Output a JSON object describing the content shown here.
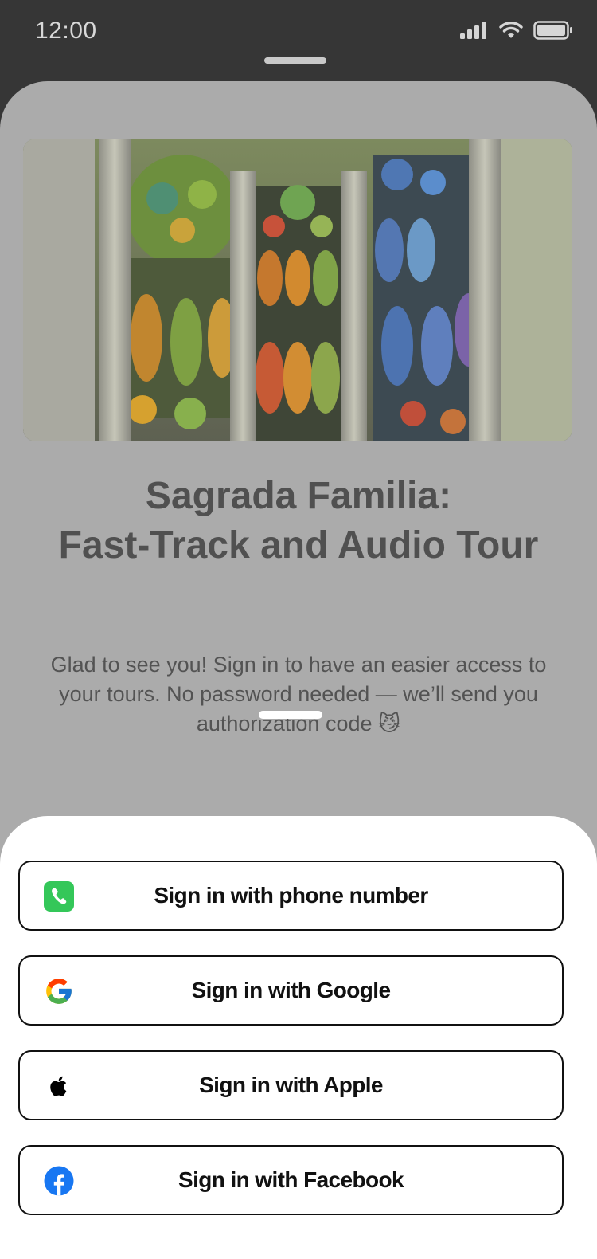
{
  "status_bar": {
    "time": "12:00"
  },
  "tour": {
    "title_line1": "Sagrada Familia:",
    "title_line2": "Fast-Track and Audio Tour",
    "description": "Glad to see you! Sign in to have an easier access to your tours. No password needed — we’ll send you authorization code 😼"
  },
  "signin": {
    "phone_label": "Sign in with phone number",
    "google_label": "Sign in with Google",
    "apple_label": "Sign in with Apple",
    "facebook_label": "Sign in with Facebook"
  },
  "icons": {
    "phone": "phone-icon",
    "google": "google-icon",
    "apple": "apple-icon",
    "facebook": "facebook-icon"
  },
  "colors": {
    "phone_green": "#34C759",
    "facebook_blue": "#1877F2",
    "dark_bg": "#363636",
    "dim_overlay": "#ababab"
  }
}
